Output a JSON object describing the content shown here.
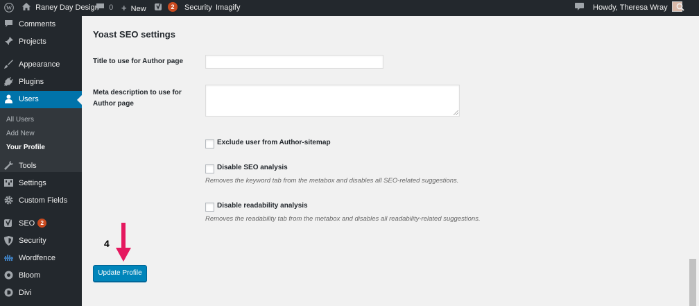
{
  "adminbar": {
    "site_name": "Raney Day Design",
    "comments_count": "0",
    "new_label": "New",
    "yoast_badge": "2",
    "security_label": "Security",
    "imagify_label": "Imagify",
    "greeting": "Howdy, Theresa Wray"
  },
  "sidebar": {
    "items": [
      {
        "label": "Comments",
        "icon": "comments-icon"
      },
      {
        "label": "Projects",
        "icon": "pin-icon"
      },
      {
        "label": "Appearance",
        "icon": "brush-icon"
      },
      {
        "label": "Plugins",
        "icon": "plug-icon"
      },
      {
        "label": "Users",
        "icon": "user-icon"
      },
      {
        "label": "Tools",
        "icon": "wrench-icon"
      },
      {
        "label": "Settings",
        "icon": "settings-icon"
      },
      {
        "label": "Custom Fields",
        "icon": "gear-icon"
      },
      {
        "label": "SEO",
        "icon": "yoast-icon",
        "badge": "2"
      },
      {
        "label": "Security",
        "icon": "shield-icon"
      },
      {
        "label": "Wordfence",
        "icon": "wordfence-icon"
      },
      {
        "label": "Bloom",
        "icon": "bloom-icon"
      },
      {
        "label": "Divi",
        "icon": "divi-icon"
      }
    ],
    "submenu": [
      "All Users",
      "Add New",
      "Your Profile"
    ]
  },
  "main": {
    "heading": "Yoast SEO settings",
    "title_label": "Title to use for Author page",
    "title_value": "",
    "meta_label_line1": "Meta description to use for",
    "meta_label_line2": "Author page",
    "meta_value": "",
    "checkboxes": [
      {
        "label": "Exclude user from Author-sitemap",
        "description": "",
        "checked": false
      },
      {
        "label": "Disable SEO analysis",
        "description": "Removes the keyword tab from the metabox and disables all SEO-related suggestions.",
        "checked": false
      },
      {
        "label": "Disable readability analysis",
        "description": "Removes the readability tab from the metabox and disables all readability-related suggestions.",
        "checked": false
      }
    ],
    "step_number": "4",
    "update_button": "Update Profile"
  },
  "colors": {
    "adminbar_bg": "#23282d",
    "sidebar_active": "#0073aa",
    "button_primary": "#0085ba",
    "badge": "#ca4a1f",
    "annotation_arrow": "#e5195f"
  }
}
